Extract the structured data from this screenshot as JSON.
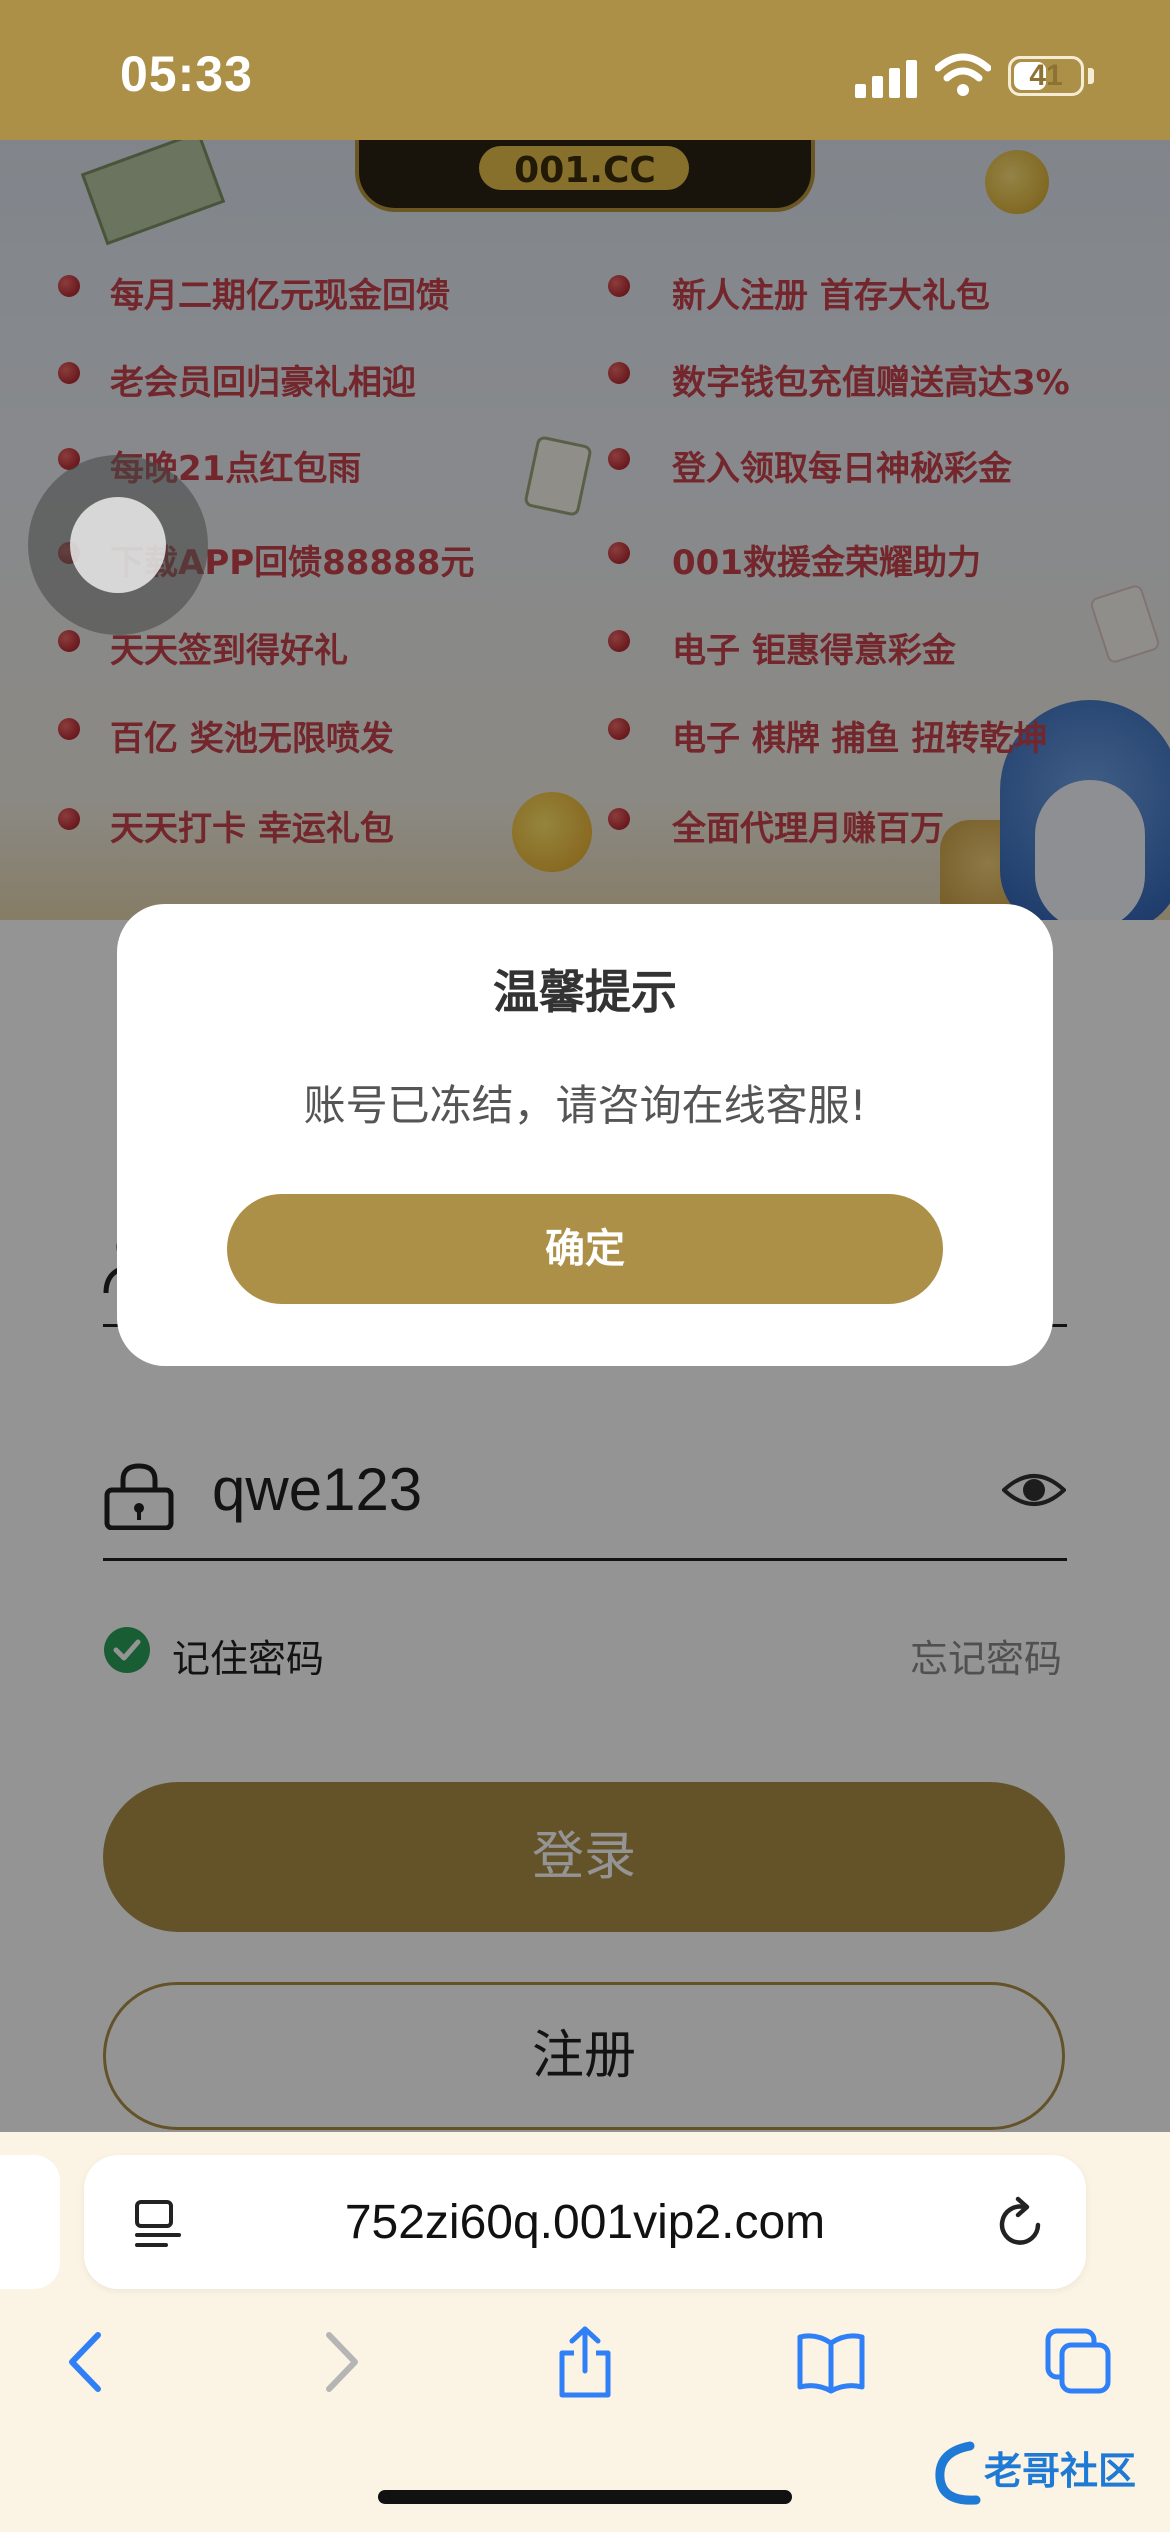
{
  "status_bar": {
    "time": "05:33",
    "battery": "41"
  },
  "banner": {
    "logo_text": "001.CC",
    "promos_left": [
      "每月二期亿元现金回馈",
      "老会员回归豪礼相迎",
      "每晚21点红包雨",
      "下载APP回馈88888元",
      "天天签到得好礼",
      "百亿 奖池无限喷发",
      "天天打卡 幸运礼包"
    ],
    "promos_right": [
      "新人注册 首存大礼包",
      "数字钱包充值赠送高达3%",
      "登入领取每日神秘彩金",
      "001救援金荣耀助力",
      "电子 钜惠得意彩金",
      "电子 棋牌 捕鱼 扭转乾坤",
      "全面代理月赚百万"
    ]
  },
  "form": {
    "password_value": "qwe123",
    "remember_label": "记住密码",
    "forgot_label": "忘记密码",
    "login_label": "登录",
    "register_label": "注册"
  },
  "dialog": {
    "title": "温馨提示",
    "message": "账号已冻结，请咨询在线客服!",
    "confirm_label": "确定"
  },
  "browser": {
    "url": "752zi60q.001vip2.com"
  },
  "watermark": {
    "text": "老哥社区"
  },
  "colors": {
    "accent": "#ad9048",
    "promo_red": "#c7434a",
    "check_green": "#2aa05a",
    "safari_blue": "#2f7ff6"
  }
}
